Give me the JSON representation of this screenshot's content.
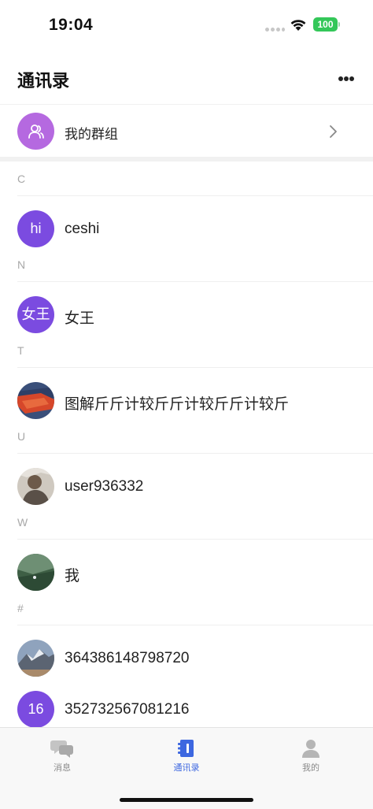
{
  "status_bar": {
    "time": "19:04",
    "battery": "100"
  },
  "header": {
    "title": "通讯录",
    "more_icon": "more-horizontal-icon"
  },
  "groups": {
    "label": "我的群组",
    "icon": "group-icon",
    "avatar_color": "#b569e0"
  },
  "sections": [
    {
      "letter": "C",
      "contacts": [
        {
          "name": "ceshi",
          "avatar_text": "hi",
          "avatar_type": "text",
          "avatar_color": "#7b4be0"
        }
      ]
    },
    {
      "letter": "N",
      "contacts": [
        {
          "name": "女王",
          "avatar_text": "女王",
          "avatar_type": "text",
          "avatar_color": "#7b4be0"
        }
      ]
    },
    {
      "letter": "T",
      "contacts": [
        {
          "name": "图解斤斤计较斤斤计较斤斤计较斤",
          "avatar_type": "image",
          "avatar_image": "red-abstract-landscape"
        }
      ]
    },
    {
      "letter": "U",
      "contacts": [
        {
          "name": "user936332",
          "avatar_type": "image",
          "avatar_image": "person-photo"
        }
      ]
    },
    {
      "letter": "W",
      "contacts": [
        {
          "name": "我",
          "avatar_type": "image",
          "avatar_image": "green-landscape"
        }
      ]
    },
    {
      "letter": "#",
      "contacts": [
        {
          "name": "364386148798720",
          "avatar_type": "image",
          "avatar_image": "mountain-photo"
        },
        {
          "name": "352732567081216",
          "avatar_text": "16",
          "avatar_type": "text",
          "avatar_color": "#7b4be0"
        }
      ]
    }
  ],
  "tabs": [
    {
      "label": "消息",
      "icon": "chat-bubbles-icon",
      "active": false
    },
    {
      "label": "通讯录",
      "icon": "contacts-book-icon",
      "active": true
    },
    {
      "label": "我的",
      "icon": "person-icon",
      "active": false
    }
  ],
  "colors": {
    "accent": "#3d67e0",
    "avatar_purple": "#7b4be0",
    "battery": "#34c759"
  }
}
